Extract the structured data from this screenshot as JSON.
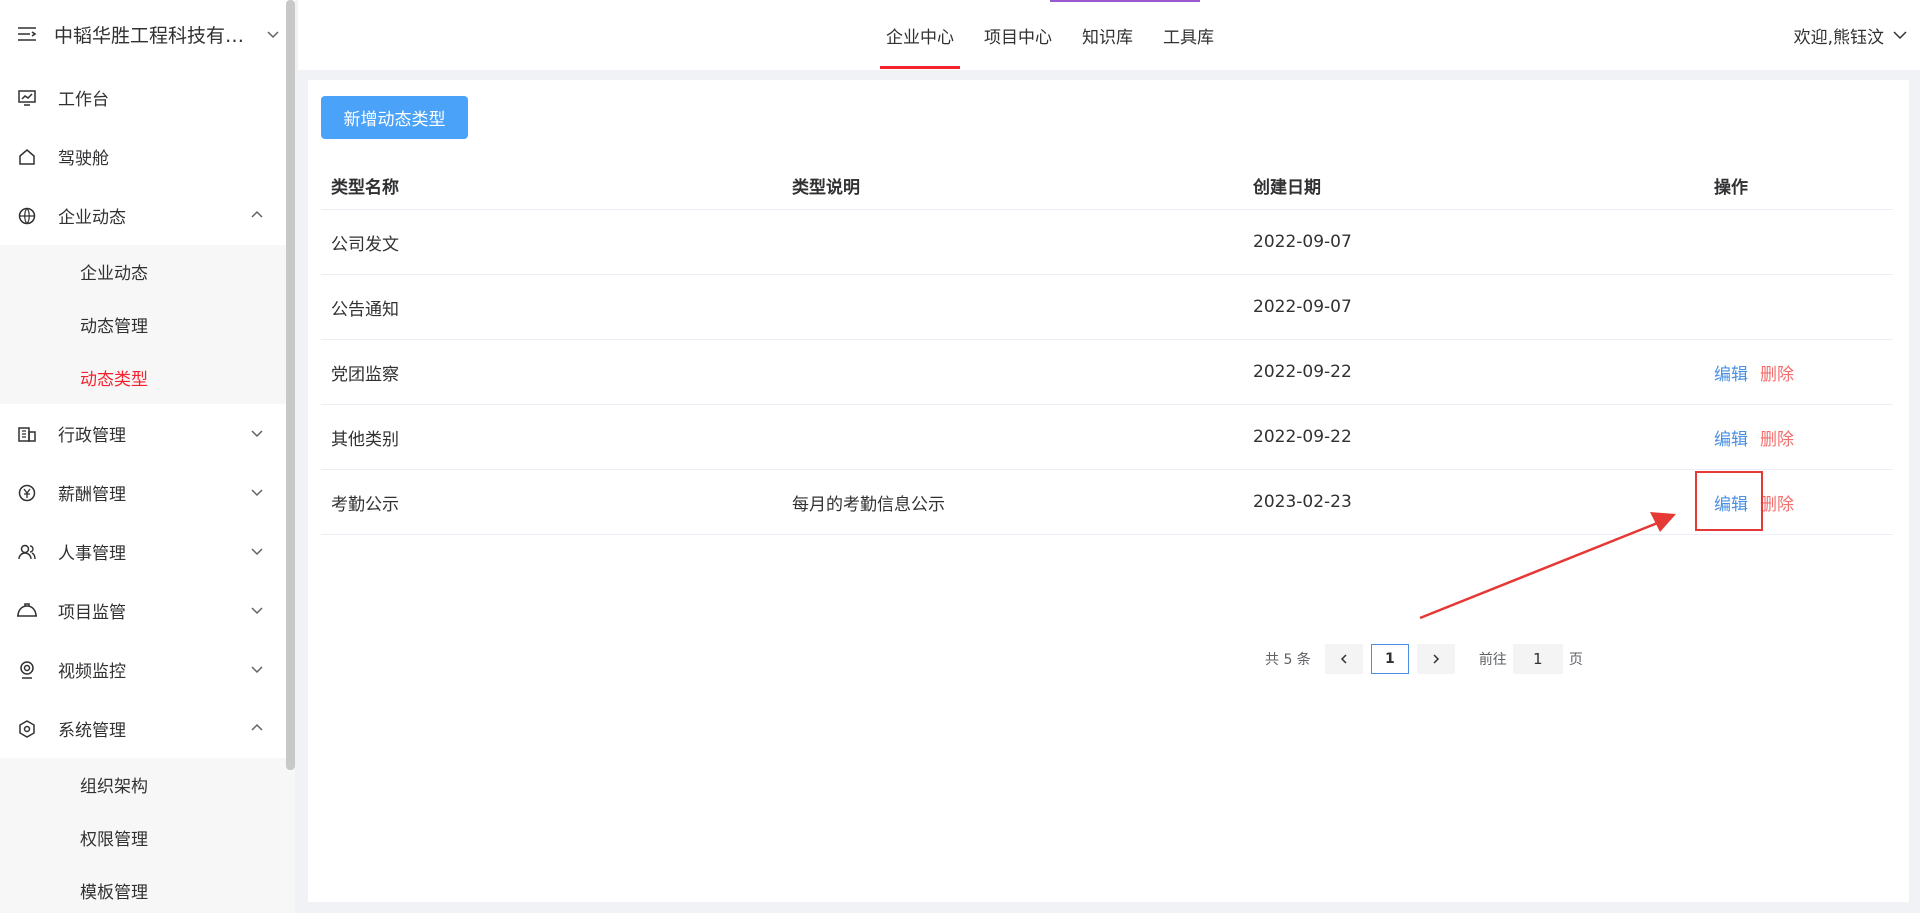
{
  "sidebar": {
    "company": "中韬华胜工程科技有限公司",
    "items": {
      "workbench": "工作台",
      "cockpit": "驾驶舱",
      "enterprise_news": "企业动态",
      "news_sub": [
        "企业动态",
        "动态管理",
        "动态类型"
      ],
      "admin": "行政管理",
      "salary": "薪酬管理",
      "hr": "人事管理",
      "project_monitor": "项目监管",
      "video_monitor": "视频监控",
      "system": "系统管理",
      "system_sub": [
        "组织架构",
        "权限管理",
        "模板管理"
      ]
    }
  },
  "topbar": {
    "tabs": [
      "企业中心",
      "项目中心",
      "知识库",
      "工具库"
    ],
    "active_tab": "企业中心",
    "user": "欢迎,熊钰汶"
  },
  "main": {
    "add_button": "新增动态类型",
    "columns": [
      "类型名称",
      "类型说明",
      "创建日期",
      "操作"
    ],
    "rows": [
      {
        "name": "公司发文",
        "desc": "",
        "date": "2022-09-07",
        "edit": "",
        "del": ""
      },
      {
        "name": "公告通知",
        "desc": "",
        "date": "2022-09-07",
        "edit": "",
        "del": ""
      },
      {
        "name": "党团监察",
        "desc": "",
        "date": "2022-09-22",
        "edit": "编辑",
        "del": "删除"
      },
      {
        "name": "其他类别",
        "desc": "",
        "date": "2022-09-22",
        "edit": "编辑",
        "del": "删除"
      },
      {
        "name": "考勤公示",
        "desc": "每月的考勤信息公示",
        "date": "2023-02-23",
        "edit": "编辑",
        "del": "删除"
      }
    ]
  },
  "pagination": {
    "total": "共 5 条",
    "current": "1",
    "goto_prefix": "前往",
    "goto_value": "1",
    "goto_suffix": "页"
  },
  "colors": {
    "accent_red": "#f5222d",
    "primary_blue": "#4aa3f8",
    "link_blue": "#4a90e2",
    "delete_red": "#f56c6c"
  }
}
